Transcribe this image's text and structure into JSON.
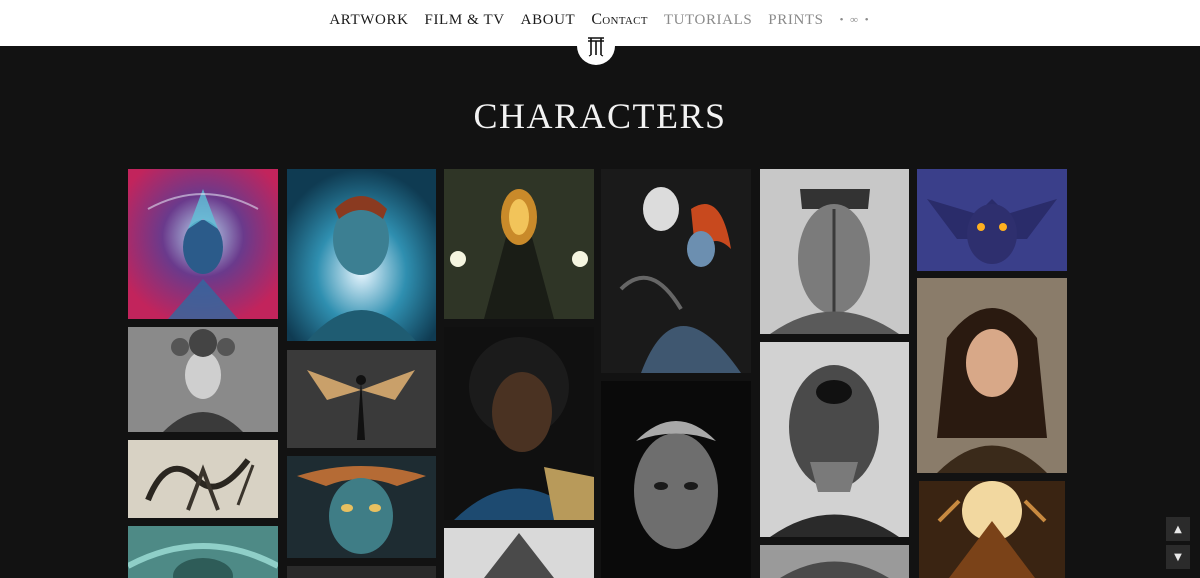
{
  "nav": {
    "items": [
      {
        "label": "ARTWORK",
        "style": "dark"
      },
      {
        "label": "FILM & TV",
        "style": "dark"
      },
      {
        "label": "ABOUT",
        "style": "dark"
      },
      {
        "label": "Contact",
        "style": "smallcaps"
      },
      {
        "label": "TUTORIALS",
        "style": "dim"
      },
      {
        "label": "PRINTS",
        "style": "dim"
      }
    ],
    "extra_symbol": "• ∞ •",
    "logo_icon": "artist-monogram-logo"
  },
  "page": {
    "title": "CHARACTERS"
  },
  "gallery": {
    "icon_names": [
      "cosmic-goddess-portrait",
      "alien-chrome-bust",
      "alien-creature-sketch",
      "teal-creature-partial",
      "blue-skinned-man-portrait",
      "winged-fairy-figure",
      "horned-tribal-mask",
      "golden-glowing-head",
      "bearded-man-portrait",
      "armored-warrior-partial",
      "skeleton-and-red-haired-woman",
      "elderly-man-bw-portrait",
      "cyborg-face-split",
      "skull-helmet-figure",
      "grey-creature-partial",
      "horned-blue-demon",
      "brunette-woman-portrait",
      "fiery-demon-partial"
    ]
  },
  "controls": {
    "scroll_up_glyph": "▲",
    "scroll_down_glyph": "▼"
  },
  "colors": {
    "header_bg": "#ffffff",
    "page_bg": "#121212",
    "title": "#f2f2f2",
    "nav_dark": "#1a1a1a",
    "nav_dim": "#8a8a8a"
  }
}
